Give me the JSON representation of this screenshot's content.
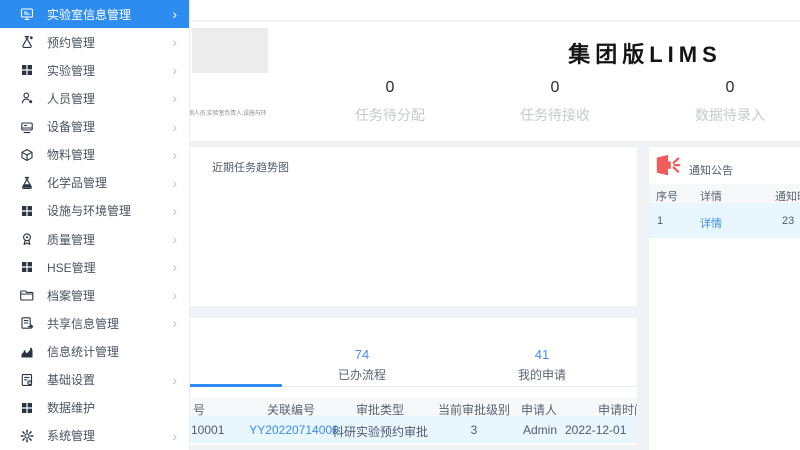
{
  "colors": {
    "accent": "#2d8cf0",
    "link": "#3c8de8",
    "alert_red": "#ee5c5c",
    "row_highlight": "#e8f6fe"
  },
  "sidebar": {
    "items": [
      {
        "key": "lab-info-management",
        "label": "实验室信息管理",
        "icon": "monitor-icon",
        "arrow": true,
        "active": true
      },
      {
        "key": "reservation-management",
        "label": "预约管理",
        "icon": "appointment-icon",
        "arrow": true,
        "active": false
      },
      {
        "key": "experiment-management",
        "label": "实验管理",
        "icon": "grid-icon",
        "arrow": true,
        "active": false
      },
      {
        "key": "personnel-management",
        "label": "人员管理",
        "icon": "user-icon",
        "arrow": true,
        "active": false
      },
      {
        "key": "equipment-management",
        "label": "设备管理",
        "icon": "device-icon",
        "arrow": true,
        "active": false
      },
      {
        "key": "material-management",
        "label": "物料管理",
        "icon": "package-icon",
        "arrow": true,
        "active": false
      },
      {
        "key": "chemical-management",
        "label": "化学品管理",
        "icon": "chemical-flask-icon",
        "arrow": true,
        "active": false
      },
      {
        "key": "facility-env-management",
        "label": "设施与环境管理",
        "icon": "grid-icon",
        "arrow": true,
        "active": false
      },
      {
        "key": "quality-management",
        "label": "质量管理",
        "icon": "quality-badge-icon",
        "arrow": true,
        "active": false
      },
      {
        "key": "hse-management",
        "label": "HSE管理",
        "icon": "grid-icon",
        "arrow": true,
        "active": false
      },
      {
        "key": "archive-management",
        "label": "档案管理",
        "icon": "folder-icon",
        "arrow": true,
        "active": false
      },
      {
        "key": "shared-info-management",
        "label": "共享信息管理",
        "icon": "share-doc-icon",
        "arrow": true,
        "active": false
      },
      {
        "key": "info-statistics",
        "label": "信息统计管理",
        "icon": "chart-icon",
        "arrow": false,
        "active": false
      },
      {
        "key": "basic-settings",
        "label": "基础设置",
        "icon": "settings-doc-icon",
        "arrow": true,
        "active": false
      },
      {
        "key": "data-maintenance",
        "label": "数据维护",
        "icon": "grid-icon",
        "arrow": false,
        "active": false
      },
      {
        "key": "system-management",
        "label": "系统管理",
        "icon": "gear-icon",
        "arrow": true,
        "active": false
      }
    ]
  },
  "header": {
    "title": "集团版LIMS",
    "roles_text": "测人员,实验室负责人,设施与环",
    "stats": [
      {
        "value": "0",
        "label": "任务待分配"
      },
      {
        "value": "0",
        "label": "任务待接收"
      },
      {
        "value": "0",
        "label": "数据待录入"
      }
    ]
  },
  "trend_panel": {
    "title": "近期任务趋势图"
  },
  "notice_panel": {
    "title": "通知公告",
    "columns": [
      "序号",
      "详情",
      "通知时间"
    ],
    "rows": [
      {
        "no": "1",
        "detail_link": "详情",
        "time": "23"
      }
    ]
  },
  "workflow_panel": {
    "stats": [
      {
        "value": "74",
        "label": "已办流程"
      },
      {
        "value": "41",
        "label": "我的申请"
      }
    ],
    "columns": [
      "号",
      "关联编号",
      "审批类型",
      "当前审批级别",
      "申请人",
      "申请时间"
    ],
    "rows": [
      {
        "no_suffix": "10001",
        "related_no": "YY20220714000",
        "approval_type": "科研实验预约审批",
        "level": "3",
        "applicant": "Admin",
        "apply_time": "2022-12-01"
      }
    ]
  }
}
